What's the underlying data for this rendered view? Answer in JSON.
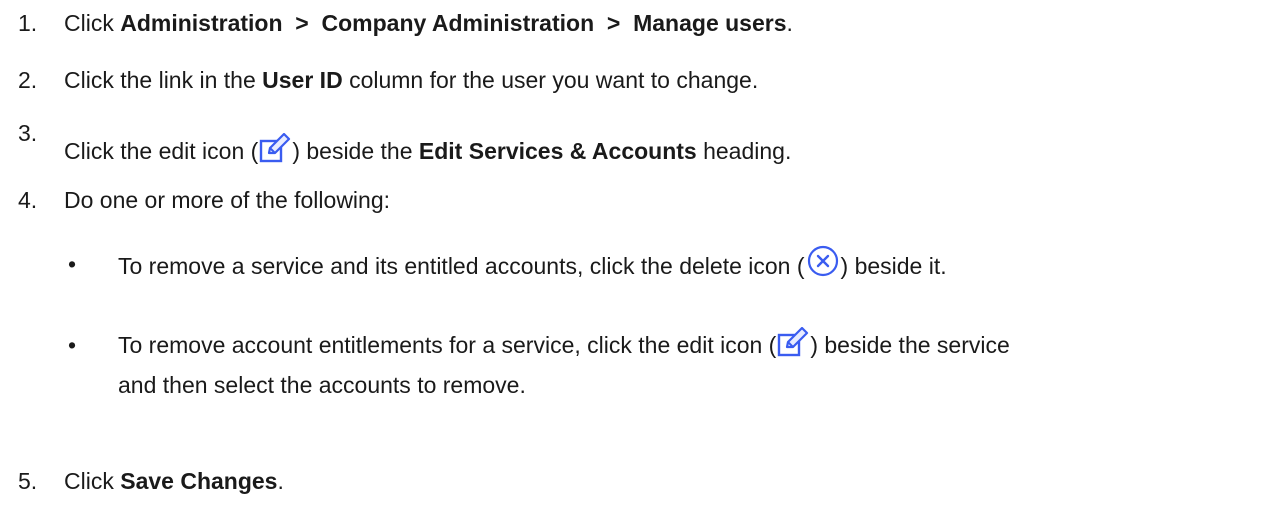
{
  "steps": [
    {
      "number": "1.",
      "parts": {
        "pre": "Click ",
        "path": "Administration  >  Company Administration  >  Manage users",
        "post": "."
      }
    },
    {
      "number": "2.",
      "parts": {
        "pre": "Click the link in the ",
        "bold": "User ID",
        "post": " column for the user you want to change."
      }
    },
    {
      "number": "3.",
      "parts": {
        "pre": "Click the edit icon (",
        "icon": "edit-icon",
        "mid": ") beside the ",
        "bold": "Edit Services & Accounts",
        "post": " heading."
      }
    },
    {
      "number": "4.",
      "parts": {
        "text": "Do one or more of the following:"
      }
    },
    {
      "number": "5.",
      "parts": {
        "pre": "Click ",
        "bold": "Save Changes",
        "post": "."
      }
    }
  ],
  "bullets": [
    {
      "pre": "To remove a service and its entitled accounts, click the delete icon (",
      "icon": "delete-icon",
      "post": ") beside it."
    },
    {
      "pre": "To remove account entitlements for a service, click the edit icon (",
      "icon": "edit-icon",
      "post": ") beside the service",
      "line2": "and then select the accounts to remove."
    }
  ],
  "bullet_glyph": "•",
  "colors": {
    "text": "#1a1a1a",
    "icon_blue": "#3a5cf0",
    "icon_fill": "#e8ecff"
  }
}
